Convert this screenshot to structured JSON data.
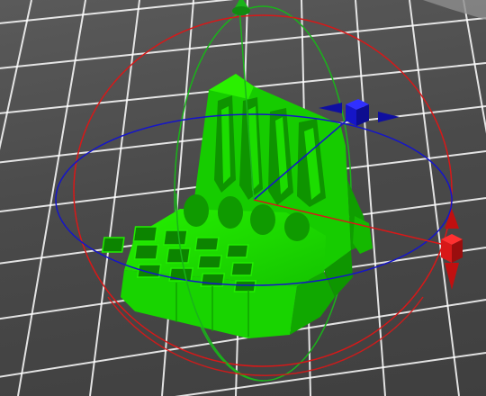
{
  "viewport": {
    "bed_color": "#4b4b4b",
    "grid_color": "#ffffff",
    "model_color": "#19e000",
    "model_shade_color": "#12a600",
    "model_dark_color": "#0c7a00"
  },
  "gizmo": {
    "x_color": "#1515c8",
    "y_color": "#d81818",
    "z_color": "#1ab31a",
    "handles": [
      {
        "name": "move-z-handle",
        "icon": "cone-icon",
        "color": "#1ab31a"
      },
      {
        "name": "move-x-handle",
        "icon": "cube-icon",
        "color": "#1515c8"
      },
      {
        "name": "move-y-handle",
        "icon": "cube-icon",
        "color": "#d81818"
      }
    ]
  }
}
